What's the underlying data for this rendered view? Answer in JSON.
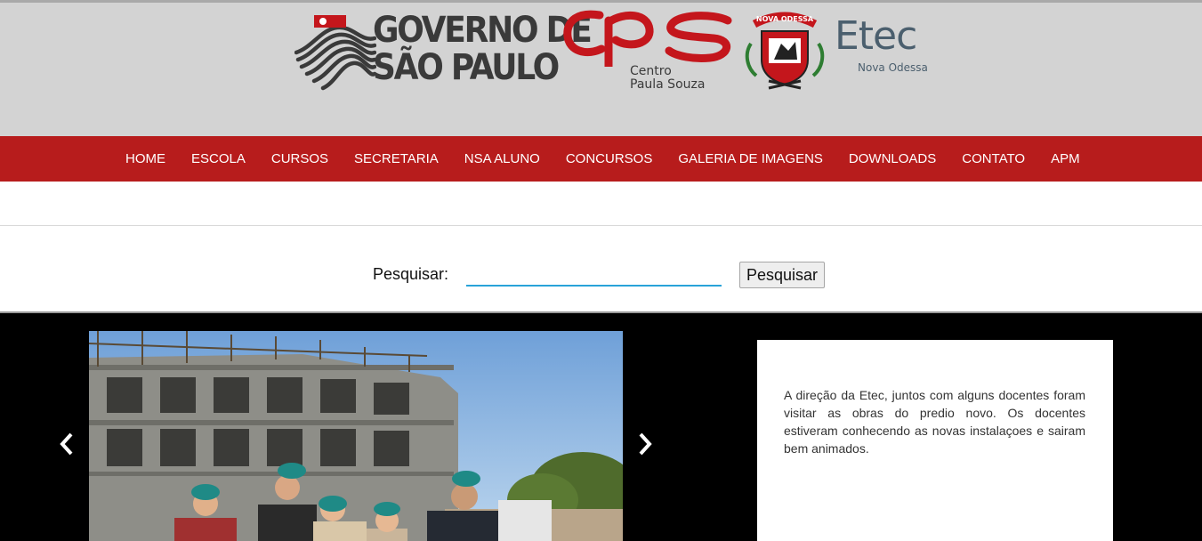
{
  "header": {
    "logo_sp": {
      "line1": "GOVERNO DE",
      "line2": "SÃO PAULO"
    },
    "logo_cps": {
      "mark": "cps",
      "line1": "Centro",
      "line2": "Paula Souza"
    },
    "logo_crest": {
      "city": "NOVA ODESSA"
    },
    "logo_etec": {
      "word": "Etec",
      "city": "Nova Odessa"
    },
    "colors": {
      "background": "#d3d3d3",
      "cps_red": "#c4161c",
      "etec_gray": "#4b5f6e"
    }
  },
  "nav": {
    "background": "#b71c1c",
    "items": [
      {
        "label": "HOME"
      },
      {
        "label": "ESCOLA"
      },
      {
        "label": "CURSOS"
      },
      {
        "label": "SECRETARIA"
      },
      {
        "label": "NSA ALUNO"
      },
      {
        "label": "CONCURSOS"
      },
      {
        "label": "GALERIA DE IMAGENS"
      },
      {
        "label": "DOWNLOADS"
      },
      {
        "label": "CONTATO"
      },
      {
        "label": "APM"
      }
    ]
  },
  "search": {
    "label": "Pesquisar:",
    "value": "",
    "button_label": "Pesquisar",
    "accent": "#29a3d8"
  },
  "slider": {
    "prev_icon": "chevron-left-icon",
    "next_icon": "chevron-right-icon",
    "photo_icon": "construction-site-photo",
    "caption": "A direção da Etec, juntos com alguns docentes foram visitar as obras do predio novo. Os docentes estiveram conhecendo as novas instalaçoes e sairam bem animados."
  }
}
